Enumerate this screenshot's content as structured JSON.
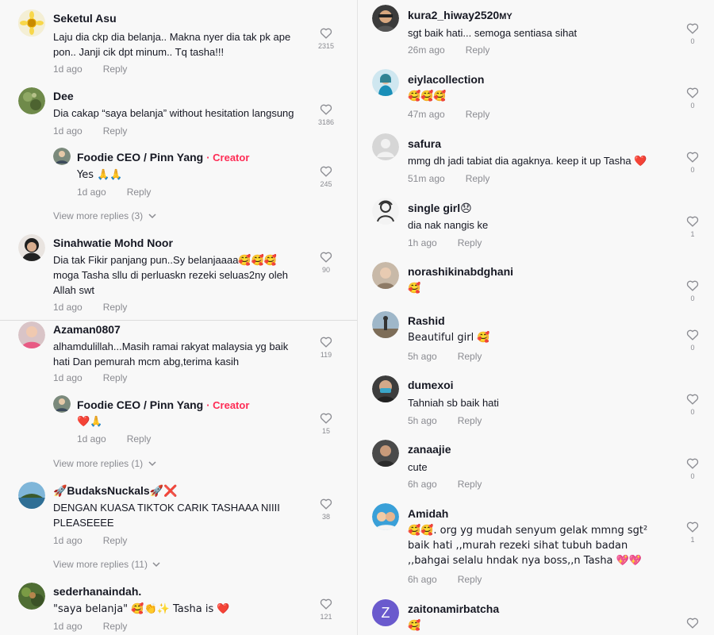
{
  "left_comments": [
    {
      "user": "Seketul Asu",
      "text": "Laju dia ckp dia belanja.. Makna nyer dia tak pk ape pon.. Janji cik dpt minum.. Tq tasha!!!",
      "time": "1d ago",
      "reply": "Reply",
      "likes": "2315"
    },
    {
      "user": "Dee",
      "text": "Dia cakap “saya belanja” without hesitation langsung",
      "time": "1d ago",
      "reply": "Reply",
      "likes": "3186"
    },
    {
      "user": "Foodie CEO / Pinn Yang",
      "creator_label": "· Creator",
      "text": "Yes 🙏🙏",
      "time": "1d ago",
      "reply": "Reply",
      "likes": "245"
    },
    {
      "user": "Sinahwatie Mohd Noor",
      "text": "Dia tak Fikir panjang pun..Sy belanjaaaa🥰🥰🥰 moga Tasha sllu di perluaskn rezeki seluas2ny oleh Allah swt",
      "time": "1d ago",
      "reply": "Reply",
      "likes": "90"
    },
    {
      "user": "Azaman0807",
      "text": "alhamdulillah...Masih ramai rakyat malaysia yg baik hati Dan pemurah mcm abg,terima kasih",
      "time": "1d ago",
      "reply": "Reply",
      "likes": "119"
    },
    {
      "user": "Foodie CEO / Pinn Yang",
      "creator_label": "· Creator",
      "text": "❤️🙏",
      "time": "1d ago",
      "reply": "Reply",
      "likes": "15"
    },
    {
      "user": "🚀BudaksNuckals🚀❌",
      "text": "DENGAN KUASA TIKTOK CARIK TASHAAA NIIII PLEASEEEE",
      "time": "1d ago",
      "reply": "Reply",
      "likes": "38"
    },
    {
      "user": "sederhanaindah.",
      "text": "\"saya belanja\" 🥰👏✨ Tasha is ❤️",
      "time": "1d ago",
      "reply": "Reply",
      "likes": "121"
    }
  ],
  "view_more": [
    "View more replies (3)",
    "View more replies (1)",
    "View more replies (11)"
  ],
  "right_comments": [
    {
      "user": "kura2_hiway2520",
      "suffix": "MY",
      "text": "sgt baik hati... semoga sentiasa sihat",
      "time": "26m ago",
      "reply": "Reply",
      "likes": "0"
    },
    {
      "user": "eiylacollection",
      "text": "🥰🥰🥰",
      "time": "47m ago",
      "reply": "Reply",
      "likes": "0"
    },
    {
      "user": "safura",
      "text": "mmg dh jadi tabiat dia agaknya. keep it up Tasha ❤️",
      "time": "51m ago",
      "reply": "Reply",
      "likes": "0"
    },
    {
      "user": "single girl😞",
      "text": "dia nak nangis ke",
      "time": "1h ago",
      "reply": "Reply",
      "likes": "1"
    },
    {
      "user": "norashikinabdghani",
      "text": "🥰",
      "time": "",
      "reply": "",
      "likes": "0"
    },
    {
      "user": "Rashid",
      "text": "Beautiful girl 🥰",
      "time": "5h ago",
      "reply": "Reply",
      "likes": "0"
    },
    {
      "user": "dumexoi",
      "text": "Tahniah sb baik hati",
      "time": "5h ago",
      "reply": "Reply",
      "likes": "0"
    },
    {
      "user": "zanaajie",
      "text": "cute",
      "time": "6h ago",
      "reply": "Reply",
      "likes": "0"
    },
    {
      "user": "Amidah",
      "text": "🥰🥰. org yg mudah senyum gelak mmng sgt² baik hati ,,murah rezeki sihat tubuh badan ,,bahgai selalu hndak nya boss,,n Tasha 💖💖",
      "time": "6h ago",
      "reply": "Reply",
      "likes": "1"
    },
    {
      "user": "zaitonamirbatcha",
      "text": "🥰",
      "time": "",
      "reply": "",
      "likes": ""
    }
  ],
  "zaiton_initial": "Z",
  "colors": {
    "creator": "#fe2c55",
    "meta": "#8a8b91",
    "text": "#161823",
    "background": "#f8f8f8"
  }
}
